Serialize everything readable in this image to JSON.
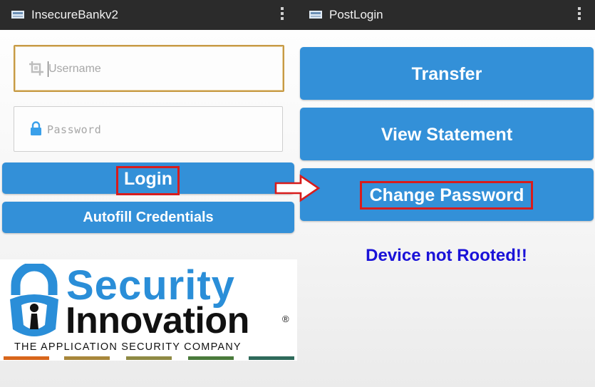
{
  "left_screen": {
    "title": "InsecureBankv2",
    "username_placeholder": "Username",
    "password_placeholder": "Password",
    "login_label": "Login",
    "autofill_label": "Autofill Credentials"
  },
  "right_screen": {
    "title": "PostLogin",
    "transfer_label": "Transfer",
    "view_statement_label": "View Statement",
    "change_password_label": "Change Password",
    "status_text": "Device not Rooted!!"
  },
  "logo": {
    "word1": "Security",
    "word2": "Innovation",
    "registered": "®",
    "tagline": "THE APPLICATION SECURITY COMPANY",
    "bar_colors": [
      "#d8661b",
      "#a8873b",
      "#8f8a44",
      "#4a7a3b",
      "#2e6a5a"
    ]
  },
  "colors": {
    "action_bar": "#2b2b2b",
    "button_blue": "#3390d8",
    "status_blue": "#1a12d8",
    "highlight_red": "#d81c1c",
    "field_focus": "#c79a44"
  },
  "icons": {
    "app": "keyboard-icon",
    "overflow": "overflow-menu-icon",
    "username": "crop-icon",
    "password": "lock-icon",
    "annotation": "right-arrow-icon"
  }
}
